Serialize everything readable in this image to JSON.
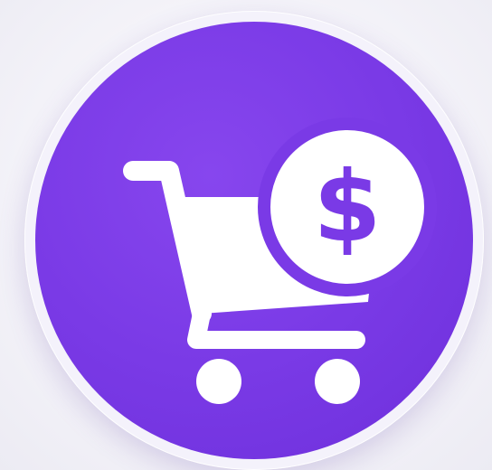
{
  "icon": {
    "name": "shopping-cart-dollar-icon",
    "badge_symbol": "$",
    "colors": {
      "background": "#f2f1f6",
      "disc": "#7a3ae6",
      "ring": "#f4f2fb",
      "glyph": "#ffffff"
    }
  }
}
